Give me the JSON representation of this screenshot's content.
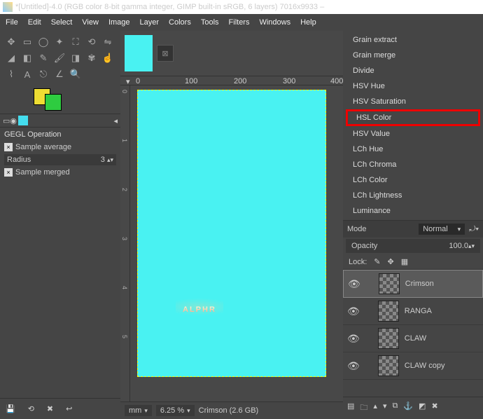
{
  "title": "*[Untitled]-4.0 (RGB color 8-bit gamma integer, GIMP built-in sRGB, 6 layers) 7016x9933 –",
  "menu": [
    "File",
    "Edit",
    "Select",
    "View",
    "Image",
    "Layer",
    "Colors",
    "Tools",
    "Filters",
    "Windows",
    "Help"
  ],
  "gegl": {
    "title": "GEGL Operation",
    "sample_avg": "Sample average",
    "radius_label": "Radius",
    "radius_val": "3",
    "sample_merged": "Sample merged"
  },
  "ruler": {
    "h": [
      "0",
      "100",
      "200",
      "300",
      "400"
    ],
    "v": [
      "0",
      "1",
      "2",
      "3",
      "4",
      "5"
    ]
  },
  "canvas_text": "ALPHR",
  "status": {
    "unit": "mm",
    "zoom": "6.25 %",
    "layer": "Crimson (2.6 GB)"
  },
  "modes": [
    "Grain extract",
    "Grain merge",
    "Divide",
    "HSV Hue",
    "HSV Saturation",
    "HSL Color",
    "HSV Value",
    "LCh Hue",
    "LCh Chroma",
    "LCh Color",
    "LCh Lightness",
    "Luminance"
  ],
  "mode_highlighted": 5,
  "mode_row": {
    "label": "Mode",
    "value": "Normal"
  },
  "opacity": {
    "label": "Opacity",
    "value": "100.0"
  },
  "lock_label": "Lock:",
  "layers": [
    {
      "name": "Crimson",
      "sel": true
    },
    {
      "name": "RANGA",
      "sel": false
    },
    {
      "name": "CLAW",
      "sel": false
    },
    {
      "name": "CLAW copy",
      "sel": false
    }
  ]
}
